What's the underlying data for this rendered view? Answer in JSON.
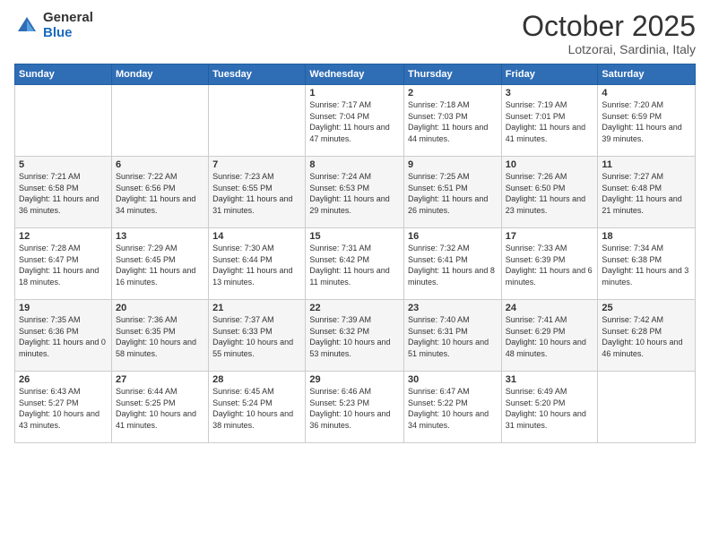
{
  "header": {
    "logo_general": "General",
    "logo_blue": "Blue",
    "month_title": "October 2025",
    "location": "Lotzorai, Sardinia, Italy"
  },
  "weekdays": [
    "Sunday",
    "Monday",
    "Tuesday",
    "Wednesday",
    "Thursday",
    "Friday",
    "Saturday"
  ],
  "weeks": [
    [
      {
        "day": "",
        "sunrise": "",
        "sunset": "",
        "daylight": ""
      },
      {
        "day": "",
        "sunrise": "",
        "sunset": "",
        "daylight": ""
      },
      {
        "day": "",
        "sunrise": "",
        "sunset": "",
        "daylight": ""
      },
      {
        "day": "1",
        "sunrise": "Sunrise: 7:17 AM",
        "sunset": "Sunset: 7:04 PM",
        "daylight": "Daylight: 11 hours and 47 minutes."
      },
      {
        "day": "2",
        "sunrise": "Sunrise: 7:18 AM",
        "sunset": "Sunset: 7:03 PM",
        "daylight": "Daylight: 11 hours and 44 minutes."
      },
      {
        "day": "3",
        "sunrise": "Sunrise: 7:19 AM",
        "sunset": "Sunset: 7:01 PM",
        "daylight": "Daylight: 11 hours and 41 minutes."
      },
      {
        "day": "4",
        "sunrise": "Sunrise: 7:20 AM",
        "sunset": "Sunset: 6:59 PM",
        "daylight": "Daylight: 11 hours and 39 minutes."
      }
    ],
    [
      {
        "day": "5",
        "sunrise": "Sunrise: 7:21 AM",
        "sunset": "Sunset: 6:58 PM",
        "daylight": "Daylight: 11 hours and 36 minutes."
      },
      {
        "day": "6",
        "sunrise": "Sunrise: 7:22 AM",
        "sunset": "Sunset: 6:56 PM",
        "daylight": "Daylight: 11 hours and 34 minutes."
      },
      {
        "day": "7",
        "sunrise": "Sunrise: 7:23 AM",
        "sunset": "Sunset: 6:55 PM",
        "daylight": "Daylight: 11 hours and 31 minutes."
      },
      {
        "day": "8",
        "sunrise": "Sunrise: 7:24 AM",
        "sunset": "Sunset: 6:53 PM",
        "daylight": "Daylight: 11 hours and 29 minutes."
      },
      {
        "day": "9",
        "sunrise": "Sunrise: 7:25 AM",
        "sunset": "Sunset: 6:51 PM",
        "daylight": "Daylight: 11 hours and 26 minutes."
      },
      {
        "day": "10",
        "sunrise": "Sunrise: 7:26 AM",
        "sunset": "Sunset: 6:50 PM",
        "daylight": "Daylight: 11 hours and 23 minutes."
      },
      {
        "day": "11",
        "sunrise": "Sunrise: 7:27 AM",
        "sunset": "Sunset: 6:48 PM",
        "daylight": "Daylight: 11 hours and 21 minutes."
      }
    ],
    [
      {
        "day": "12",
        "sunrise": "Sunrise: 7:28 AM",
        "sunset": "Sunset: 6:47 PM",
        "daylight": "Daylight: 11 hours and 18 minutes."
      },
      {
        "day": "13",
        "sunrise": "Sunrise: 7:29 AM",
        "sunset": "Sunset: 6:45 PM",
        "daylight": "Daylight: 11 hours and 16 minutes."
      },
      {
        "day": "14",
        "sunrise": "Sunrise: 7:30 AM",
        "sunset": "Sunset: 6:44 PM",
        "daylight": "Daylight: 11 hours and 13 minutes."
      },
      {
        "day": "15",
        "sunrise": "Sunrise: 7:31 AM",
        "sunset": "Sunset: 6:42 PM",
        "daylight": "Daylight: 11 hours and 11 minutes."
      },
      {
        "day": "16",
        "sunrise": "Sunrise: 7:32 AM",
        "sunset": "Sunset: 6:41 PM",
        "daylight": "Daylight: 11 hours and 8 minutes."
      },
      {
        "day": "17",
        "sunrise": "Sunrise: 7:33 AM",
        "sunset": "Sunset: 6:39 PM",
        "daylight": "Daylight: 11 hours and 6 minutes."
      },
      {
        "day": "18",
        "sunrise": "Sunrise: 7:34 AM",
        "sunset": "Sunset: 6:38 PM",
        "daylight": "Daylight: 11 hours and 3 minutes."
      }
    ],
    [
      {
        "day": "19",
        "sunrise": "Sunrise: 7:35 AM",
        "sunset": "Sunset: 6:36 PM",
        "daylight": "Daylight: 11 hours and 0 minutes."
      },
      {
        "day": "20",
        "sunrise": "Sunrise: 7:36 AM",
        "sunset": "Sunset: 6:35 PM",
        "daylight": "Daylight: 10 hours and 58 minutes."
      },
      {
        "day": "21",
        "sunrise": "Sunrise: 7:37 AM",
        "sunset": "Sunset: 6:33 PM",
        "daylight": "Daylight: 10 hours and 55 minutes."
      },
      {
        "day": "22",
        "sunrise": "Sunrise: 7:39 AM",
        "sunset": "Sunset: 6:32 PM",
        "daylight": "Daylight: 10 hours and 53 minutes."
      },
      {
        "day": "23",
        "sunrise": "Sunrise: 7:40 AM",
        "sunset": "Sunset: 6:31 PM",
        "daylight": "Daylight: 10 hours and 51 minutes."
      },
      {
        "day": "24",
        "sunrise": "Sunrise: 7:41 AM",
        "sunset": "Sunset: 6:29 PM",
        "daylight": "Daylight: 10 hours and 48 minutes."
      },
      {
        "day": "25",
        "sunrise": "Sunrise: 7:42 AM",
        "sunset": "Sunset: 6:28 PM",
        "daylight": "Daylight: 10 hours and 46 minutes."
      }
    ],
    [
      {
        "day": "26",
        "sunrise": "Sunrise: 6:43 AM",
        "sunset": "Sunset: 5:27 PM",
        "daylight": "Daylight: 10 hours and 43 minutes."
      },
      {
        "day": "27",
        "sunrise": "Sunrise: 6:44 AM",
        "sunset": "Sunset: 5:25 PM",
        "daylight": "Daylight: 10 hours and 41 minutes."
      },
      {
        "day": "28",
        "sunrise": "Sunrise: 6:45 AM",
        "sunset": "Sunset: 5:24 PM",
        "daylight": "Daylight: 10 hours and 38 minutes."
      },
      {
        "day": "29",
        "sunrise": "Sunrise: 6:46 AM",
        "sunset": "Sunset: 5:23 PM",
        "daylight": "Daylight: 10 hours and 36 minutes."
      },
      {
        "day": "30",
        "sunrise": "Sunrise: 6:47 AM",
        "sunset": "Sunset: 5:22 PM",
        "daylight": "Daylight: 10 hours and 34 minutes."
      },
      {
        "day": "31",
        "sunrise": "Sunrise: 6:49 AM",
        "sunset": "Sunset: 5:20 PM",
        "daylight": "Daylight: 10 hours and 31 minutes."
      },
      {
        "day": "",
        "sunrise": "",
        "sunset": "",
        "daylight": ""
      }
    ]
  ]
}
